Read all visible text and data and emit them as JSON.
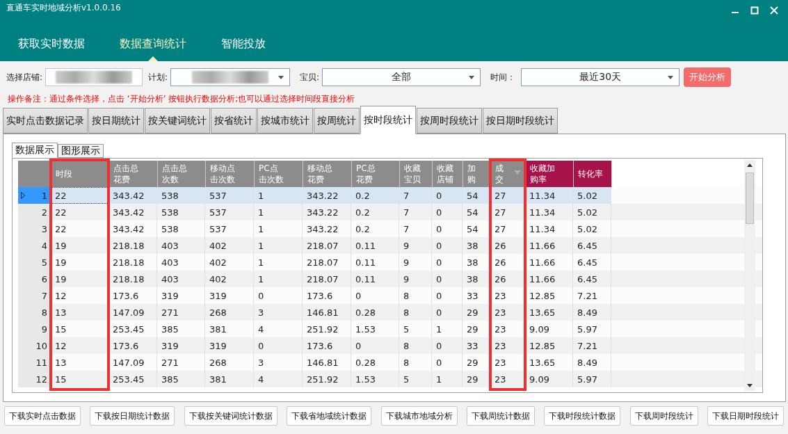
{
  "window": {
    "title": "直通车实时地域分析v1.0.0.16"
  },
  "nav": [
    {
      "label": "获取实时数据",
      "selected": false
    },
    {
      "label": "数据查询统计",
      "selected": true
    },
    {
      "label": "智能投放",
      "selected": false
    }
  ],
  "filters": {
    "shop_label": "选择店铺:",
    "plan_label": "计划:",
    "item_label": "宝贝:",
    "item_value": "全部",
    "time_label": "时间：",
    "time_value": "最近30天",
    "start_button": "开始分析"
  },
  "note": "操作备注：通过条件选择，点击 ‘开始分析’ 按钮执行数据分析;也可以通过选择时间段直接分析",
  "tabs": [
    {
      "label": "实时点击数据记录",
      "selected": false
    },
    {
      "label": "按日期统计",
      "selected": false
    },
    {
      "label": "按关键词统计",
      "selected": false
    },
    {
      "label": "按省统计",
      "selected": false
    },
    {
      "label": "按城市统计",
      "selected": false
    },
    {
      "label": "按周统计",
      "selected": false
    },
    {
      "label": "按时段统计",
      "selected": true
    },
    {
      "label": "按周时段统计",
      "selected": false
    },
    {
      "label": "按日期时段统计",
      "selected": false
    }
  ],
  "sub_tabs": [
    {
      "label": "数据展示",
      "selected": true
    },
    {
      "label": "图形展示",
      "selected": false
    }
  ],
  "table": {
    "columns": [
      {
        "label": "时段",
        "kind": "plain",
        "sorted": false,
        "highlighted": true
      },
      {
        "label": "点击总花费",
        "kind": "plain",
        "sorted": false,
        "highlighted": false
      },
      {
        "label": "点击总次数",
        "kind": "plain",
        "sorted": false,
        "highlighted": false
      },
      {
        "label": "移动点击次数",
        "kind": "plain",
        "sorted": false,
        "highlighted": false
      },
      {
        "label": "PC点击次数",
        "kind": "plain",
        "sorted": false,
        "highlighted": false
      },
      {
        "label": "移动总花费",
        "kind": "plain",
        "sorted": false,
        "highlighted": false
      },
      {
        "label": "PC总花费",
        "kind": "plain",
        "sorted": false,
        "highlighted": false
      },
      {
        "label": "收藏宝贝",
        "kind": "plain",
        "sorted": false,
        "highlighted": false
      },
      {
        "label": "收藏店铺",
        "kind": "plain",
        "sorted": false,
        "highlighted": false
      },
      {
        "label": "加购",
        "kind": "plain",
        "sorted": false,
        "highlighted": false
      },
      {
        "label": "成交",
        "kind": "plain",
        "sorted": true,
        "highlighted": true
      },
      {
        "label": "收藏加购率",
        "kind": "accent",
        "sorted": false,
        "highlighted": false
      },
      {
        "label": "转化率",
        "kind": "accent",
        "sorted": false,
        "highlighted": false
      }
    ],
    "rows": [
      {
        "number": "1",
        "selected": true,
        "cells": [
          "22",
          "343.42",
          "538",
          "537",
          "1",
          "343.22",
          "0.2",
          "7",
          "0",
          "54",
          "27",
          "11.34",
          "5.02"
        ]
      },
      {
        "number": "2",
        "selected": false,
        "cells": [
          "22",
          "343.42",
          "538",
          "537",
          "1",
          "343.22",
          "0.2",
          "7",
          "0",
          "54",
          "27",
          "11.34",
          "5.02"
        ]
      },
      {
        "number": "3",
        "selected": false,
        "cells": [
          "22",
          "343.42",
          "538",
          "537",
          "1",
          "343.22",
          "0.2",
          "7",
          "0",
          "54",
          "27",
          "11.34",
          "5.02"
        ]
      },
      {
        "number": "4",
        "selected": false,
        "cells": [
          "19",
          "218.18",
          "403",
          "402",
          "1",
          "218.07",
          "0.11",
          "9",
          "0",
          "38",
          "26",
          "11.66",
          "6.45"
        ]
      },
      {
        "number": "5",
        "selected": false,
        "cells": [
          "19",
          "218.18",
          "403",
          "402",
          "1",
          "218.07",
          "0.11",
          "9",
          "0",
          "38",
          "26",
          "11.66",
          "6.45"
        ]
      },
      {
        "number": "6",
        "selected": false,
        "cells": [
          "19",
          "218.18",
          "403",
          "402",
          "1",
          "218.07",
          "0.11",
          "9",
          "0",
          "38",
          "26",
          "11.66",
          "6.45"
        ]
      },
      {
        "number": "7",
        "selected": false,
        "cells": [
          "12",
          "173.6",
          "319",
          "319",
          "0",
          "173.6",
          "0",
          "8",
          "0",
          "33",
          "23",
          "12.85",
          "7.21"
        ]
      },
      {
        "number": "8",
        "selected": false,
        "cells": [
          "13",
          "147.09",
          "271",
          "268",
          "3",
          "146.81",
          "0.28",
          "8",
          "0",
          "29",
          "23",
          "13.65",
          "8.49"
        ]
      },
      {
        "number": "9",
        "selected": false,
        "cells": [
          "15",
          "253.45",
          "385",
          "381",
          "4",
          "251.92",
          "1.53",
          "5",
          "1",
          "29",
          "23",
          "9.09",
          "5.97"
        ]
      },
      {
        "number": "10",
        "selected": false,
        "cells": [
          "12",
          "173.6",
          "319",
          "319",
          "0",
          "173.6",
          "0",
          "8",
          "0",
          "33",
          "23",
          "12.85",
          "7.21"
        ]
      },
      {
        "number": "11",
        "selected": false,
        "cells": [
          "13",
          "147.09",
          "271",
          "268",
          "3",
          "146.81",
          "0.28",
          "8",
          "0",
          "29",
          "23",
          "13.65",
          "8.49"
        ]
      },
      {
        "number": "12",
        "selected": false,
        "cells": [
          "15",
          "253.45",
          "385",
          "381",
          "4",
          "251.92",
          "1.53",
          "5",
          "1",
          "29",
          "23",
          "9.09",
          "5.97"
        ]
      }
    ]
  },
  "download_buttons": [
    "下载实时点击数据",
    "下载按日期统计数据",
    "下载按关键词统计数据",
    "下载省地域统计数据",
    "下载城市地域分析",
    "下载周统计数据",
    "下载时段统计数据",
    "下载周时段统计",
    "下载日期时段统计"
  ]
}
